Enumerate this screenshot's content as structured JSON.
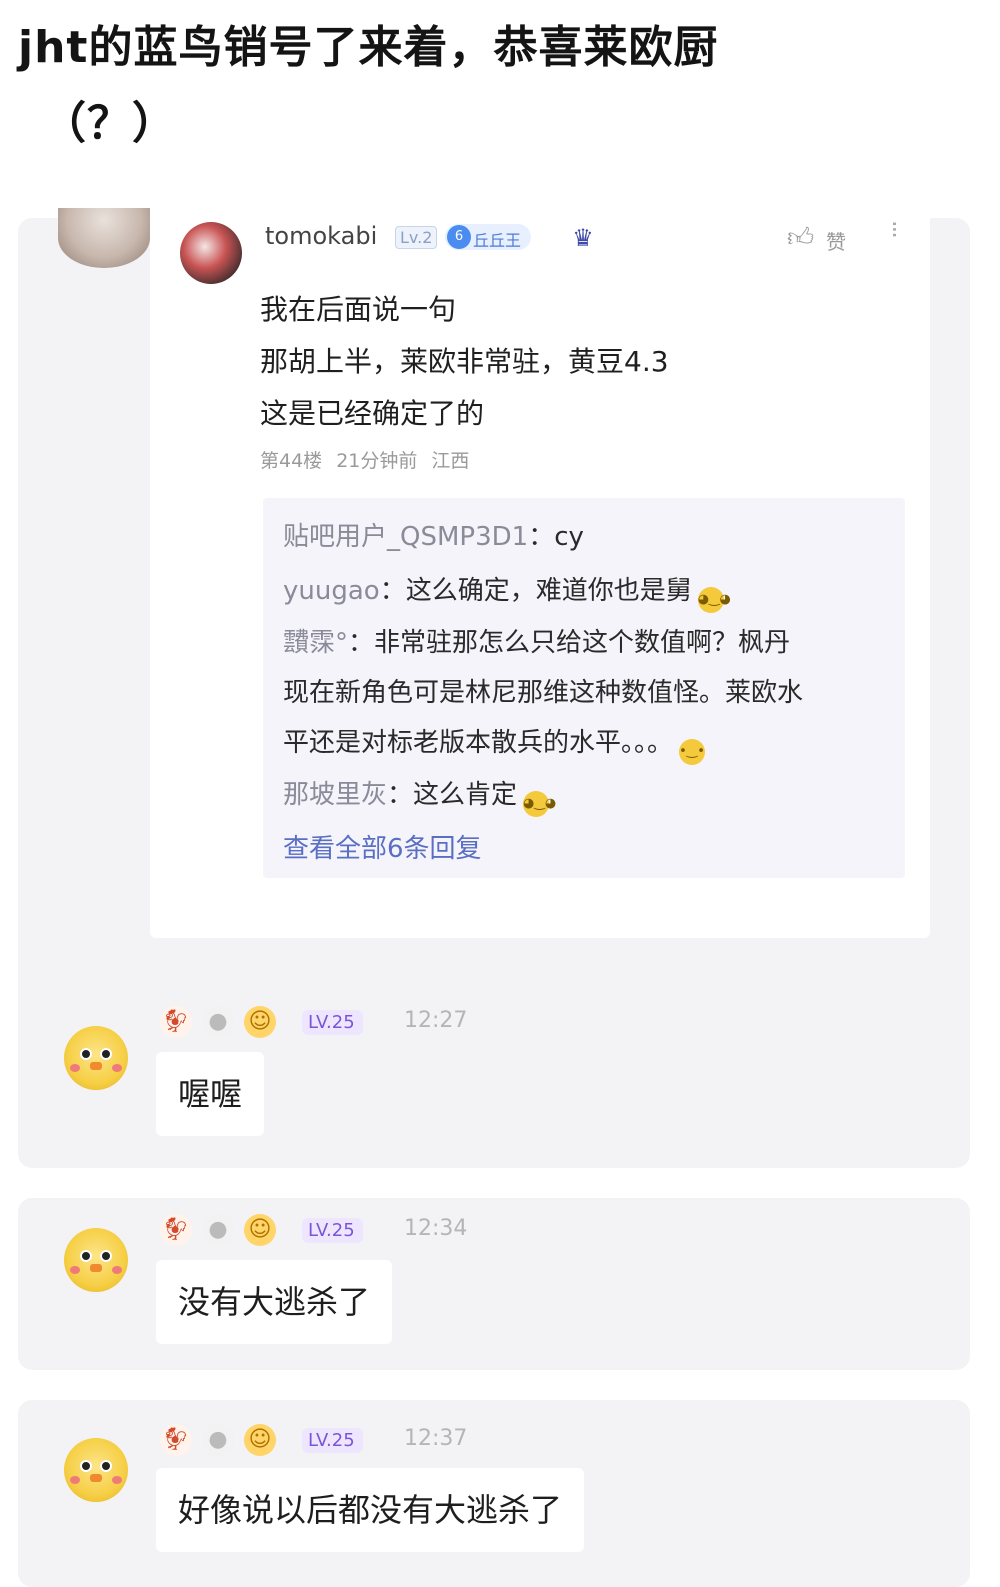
{
  "headline": {
    "line1": "jht的蓝鸟销号了来着，恭喜莱欧厨",
    "line2": "（？）"
  },
  "post": {
    "username": "tomokabi",
    "level": "Lv.2",
    "title_badge_num": "6",
    "title_badge": "丘丘王",
    "like_label": "赞",
    "body": [
      "我在后面说一句",
      "那胡上半，莱欧非常驻，黄豆4.3",
      "这是已经确定了的"
    ],
    "meta": "第44楼 21分钟前 江西",
    "replies": [
      {
        "who": "贴吧用户_QSMP3D1",
        "text": "：cy"
      },
      {
        "who": "yuugao",
        "text": "：这么确定，难道你也是舅"
      },
      {
        "who": "靅霂°",
        "text": "：非常驻那怎么只给这个数值啊？枫丹",
        "cont": [
          "现在新角色可是林尼那维这种数值怪。莱欧水",
          "平还是对标老版本散兵的水平。。。"
        ]
      },
      {
        "who": "那坡里灰",
        "text": "：这么肯定"
      }
    ],
    "view_all": "查看全部6条回复"
  },
  "comments": [
    {
      "level": "LV.25",
      "time": "12:27",
      "text": "喔喔"
    },
    {
      "level": "LV.25",
      "time": "12:34",
      "text": "没有大逃杀了"
    },
    {
      "level": "LV.25",
      "time": "12:37",
      "text": "好像说以后都没有大逃杀了"
    }
  ],
  "icons": {
    "like": "thumbs-up-icon",
    "more": "more-vertical-icon",
    "crown": "crown-badge-icon",
    "reaction": [
      "rooster-icon",
      "egg-icon",
      "baby-icon"
    ]
  },
  "colors": {
    "lv_purple": "#7a55d8",
    "title_blue": "#4a7bd8",
    "view_all": "#5a6fc4"
  }
}
